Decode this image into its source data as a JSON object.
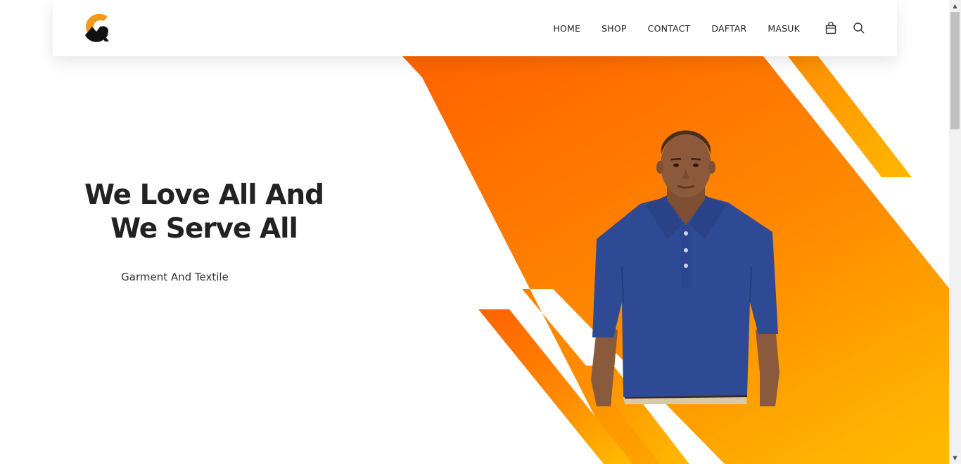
{
  "nav": {
    "logo_icon": "brand-logo-icon",
    "items": [
      {
        "label": "HOME"
      },
      {
        "label": "SHOP"
      },
      {
        "label": "CONTACT"
      },
      {
        "label": "DAFTAR"
      },
      {
        "label": "MASUK"
      }
    ],
    "cart_icon": "shopping-bag-icon",
    "search_icon": "search-icon"
  },
  "hero": {
    "headline_line1": "We Love All And",
    "headline_line2": "We Serve All",
    "subtitle": "Garment And Textile",
    "image": "man-in-blue-polo-shirt"
  },
  "colors": {
    "accent_orange": "#ff6a00",
    "accent_yellow": "#ffb300",
    "text_dark": "#222222"
  },
  "scrollbar": {
    "up_glyph": "▲",
    "down_glyph": "▼"
  }
}
